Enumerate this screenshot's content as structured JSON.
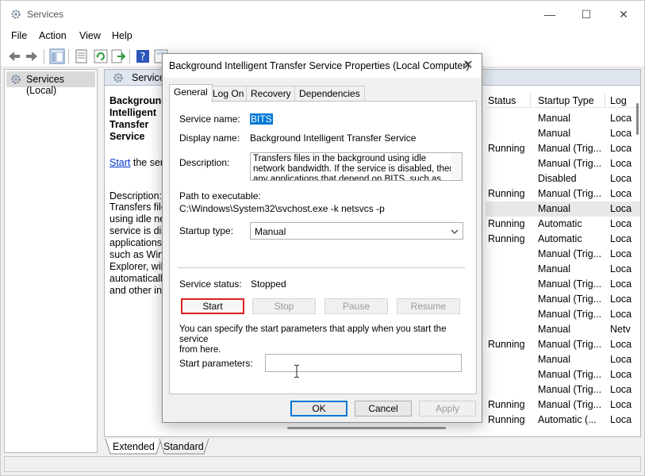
{
  "window": {
    "title": "Services",
    "controls": {
      "minimize": "—",
      "maximize": "☐",
      "close": "✕"
    }
  },
  "menu": [
    "File",
    "Action",
    "View",
    "Help"
  ],
  "tree": {
    "label": "Services (Local)"
  },
  "right_pane": {
    "header": "Services",
    "service_title": "Background Intelligent Transfer Service",
    "start_link": "Start",
    "start_suffix": " the servi",
    "description_label": "Description:",
    "description_text": "Transfers files\nusing idle net\nservice is disa\napplications t\nsuch as Wind\nExplorer, will\nautomatically\nand other inf",
    "columns": [
      "Status",
      "Startup Type",
      "Log"
    ],
    "rows": [
      {
        "status": "",
        "startup": "Manual",
        "log": "Loca"
      },
      {
        "status": "",
        "startup": "Manual",
        "log": "Loca"
      },
      {
        "status": "Running",
        "startup": "Manual (Trig...",
        "log": "Loca"
      },
      {
        "status": "",
        "startup": "Manual (Trig...",
        "log": "Loca"
      },
      {
        "status": "",
        "startup": "Disabled",
        "log": "Loca"
      },
      {
        "status": "Running",
        "startup": "Manual (Trig...",
        "log": "Loca"
      },
      {
        "status": "",
        "startup": "Manual",
        "log": "Loca"
      },
      {
        "status": "Running",
        "startup": "Automatic",
        "log": "Loca"
      },
      {
        "status": "Running",
        "startup": "Automatic",
        "log": "Loca"
      },
      {
        "status": "",
        "startup": "Manual (Trig...",
        "log": "Loca"
      },
      {
        "status": "",
        "startup": "Manual",
        "log": "Loca"
      },
      {
        "status": "",
        "startup": "Manual (Trig...",
        "log": "Loca"
      },
      {
        "status": "",
        "startup": "Manual (Trig...",
        "log": "Loca"
      },
      {
        "status": "",
        "startup": "Manual (Trig...",
        "log": "Loca"
      },
      {
        "status": "",
        "startup": "Manual",
        "log": "Netv"
      },
      {
        "status": "Running",
        "startup": "Manual (Trig...",
        "log": "Loca"
      },
      {
        "status": "",
        "startup": "Manual",
        "log": "Loca"
      },
      {
        "status": "",
        "startup": "Manual (Trig...",
        "log": "Loca"
      },
      {
        "status": "",
        "startup": "Manual (Trig...",
        "log": "Loca"
      },
      {
        "status": "Running",
        "startup": "Manual (Trig...",
        "log": "Loca"
      },
      {
        "status": "Running",
        "startup": "Automatic (...",
        "log": "Loca"
      }
    ],
    "bottom_tabs": [
      "Extended",
      "Standard"
    ]
  },
  "dialog": {
    "title": "Background Intelligent Transfer Service Properties (Local Computer)",
    "close": "✕",
    "tabs": [
      "General",
      "Log On",
      "Recovery",
      "Dependencies"
    ],
    "service_name_label": "Service name:",
    "service_name": "BITS",
    "display_name_label": "Display name:",
    "display_name": "Background Intelligent Transfer Service",
    "description_label": "Description:",
    "description": "Transfers files in the background using idle network bandwidth. If the service is disabled, then any applications that depend on BITS, such as Windows",
    "path_label": "Path to executable:",
    "path": "C:\\Windows\\System32\\svchost.exe -k netsvcs -p",
    "startup_type_label": "Startup type:",
    "startup_type": "Manual",
    "status_label": "Service status:",
    "status": "Stopped",
    "buttons": {
      "start": "Start",
      "stop": "Stop",
      "pause": "Pause",
      "resume": "Resume"
    },
    "hint": "You can specify the start parameters that apply when you start the service\nfrom here.",
    "params_label": "Start parameters:",
    "params_value": "",
    "footer": {
      "ok": "OK",
      "cancel": "Cancel",
      "apply": "Apply"
    }
  }
}
